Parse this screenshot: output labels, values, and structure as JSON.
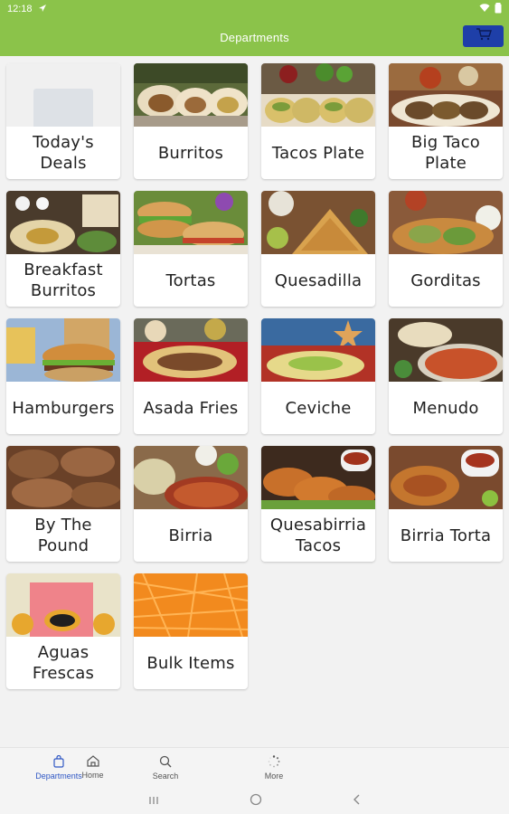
{
  "status_bar": {
    "time": "12:18"
  },
  "header": {
    "title": "Departments",
    "cart_icon": "cart-icon"
  },
  "departments": [
    {
      "label": "Today's Deals"
    },
    {
      "label": "Burritos"
    },
    {
      "label": "Tacos Plate"
    },
    {
      "label": "Big Taco Plate"
    },
    {
      "label": "Breakfast Burritos"
    },
    {
      "label": "Tortas"
    },
    {
      "label": "Quesadilla"
    },
    {
      "label": "Gorditas"
    },
    {
      "label": "Hamburgers"
    },
    {
      "label": "Asada Fries"
    },
    {
      "label": "Ceviche"
    },
    {
      "label": "Menudo"
    },
    {
      "label": "By The Pound"
    },
    {
      "label": "Birria"
    },
    {
      "label": "Quesabirria Tacos"
    },
    {
      "label": "Birria Torta"
    },
    {
      "label": "Aguas Frescas"
    },
    {
      "label": "Bulk Items"
    }
  ],
  "bottom_nav": [
    {
      "label": "Home",
      "icon": "home-icon"
    },
    {
      "label": "Departments",
      "icon": "shopping-bag-icon",
      "active": true
    },
    {
      "label": "Search",
      "icon": "search-icon"
    },
    {
      "label": "More",
      "icon": "loading-dots-icon"
    }
  ],
  "theme": {
    "primary": "#8bc34a",
    "cart_button": "#1e3fa8",
    "active_nav": "#2f57c4"
  }
}
